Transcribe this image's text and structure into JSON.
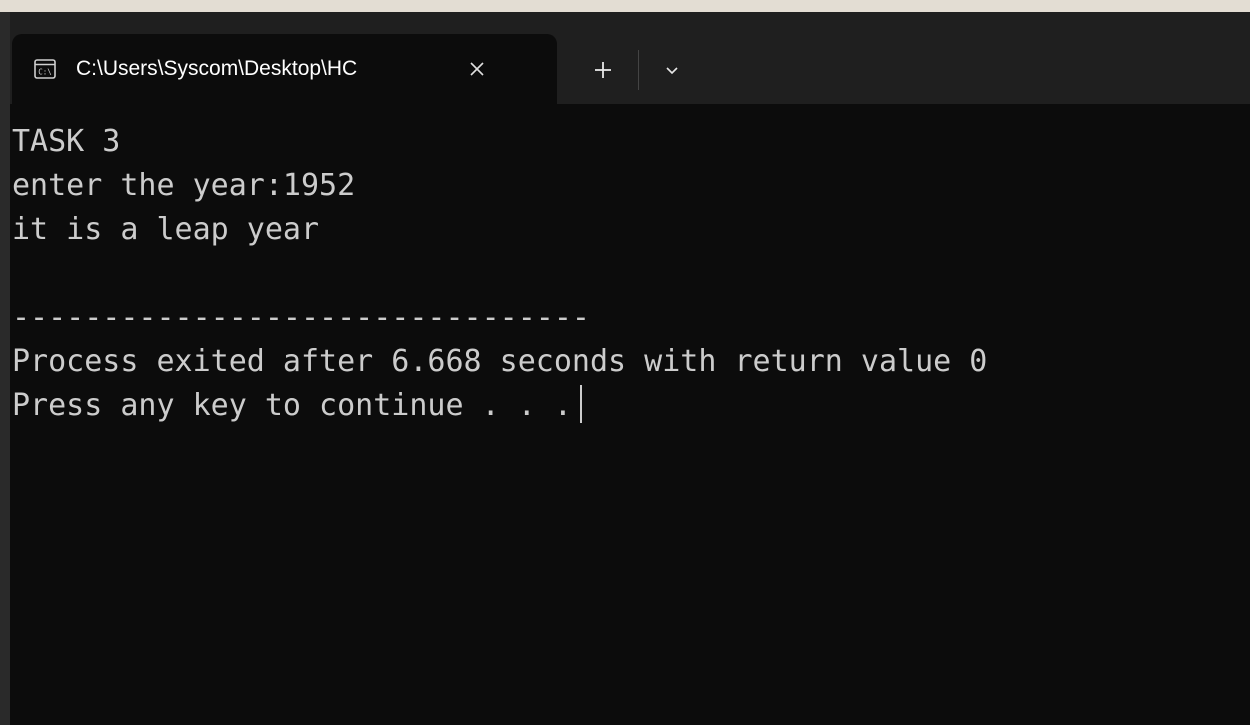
{
  "tab": {
    "title": "C:\\Users\\Syscom\\Desktop\\HC",
    "icon": "cmd-terminal-icon"
  },
  "controls": {
    "new_tab": "+",
    "close_icon": "close-icon",
    "dropdown_icon": "chevron-down-icon"
  },
  "terminal": {
    "lines": [
      "TASK 3",
      "enter the year:1952",
      "it is a leap year",
      "",
      "--------------------------------",
      "Process exited after 6.668 seconds with return value 0",
      "Press any key to continue . . ."
    ]
  },
  "colors": {
    "background": "#0c0c0c",
    "titlebar": "#1f1f1f",
    "text": "#cccccc"
  }
}
